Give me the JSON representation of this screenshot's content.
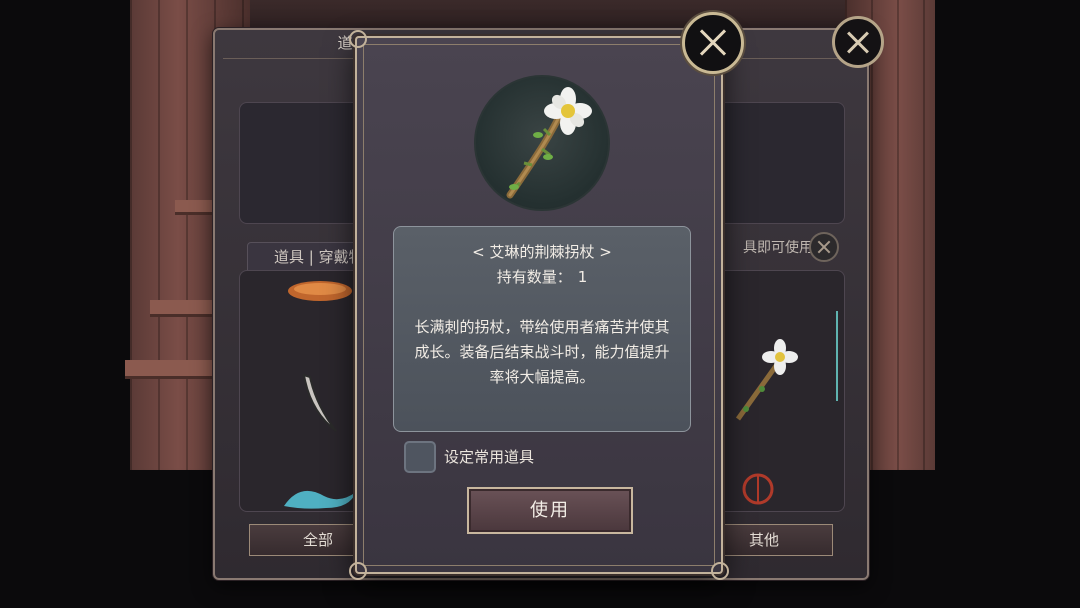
{
  "background_panel": {
    "title": "道具保管箱",
    "tab_label": "道具 | 穿戴物品",
    "hint_text": "具即可使用",
    "filter_buttons": [
      "全部",
      "其他"
    ]
  },
  "item_dialog": {
    "name": "< 艾琳的荆棘拐杖 >",
    "quantity_label": "持有数量：",
    "quantity_value": "1",
    "description": "长满刺的拐杖，带给使用者痛苦并使其成长。装备后结束战斗时，能力值提升率将大幅提高。",
    "favorite_label": "设定常用道具",
    "use_button": "使用",
    "icons": {
      "close": "close-icon",
      "item": "thorn-staff-icon"
    }
  },
  "colors": {
    "panel_border": "#c2b29b",
    "info_box": "#545a63",
    "accent_scroll": "#5fb3b0"
  }
}
